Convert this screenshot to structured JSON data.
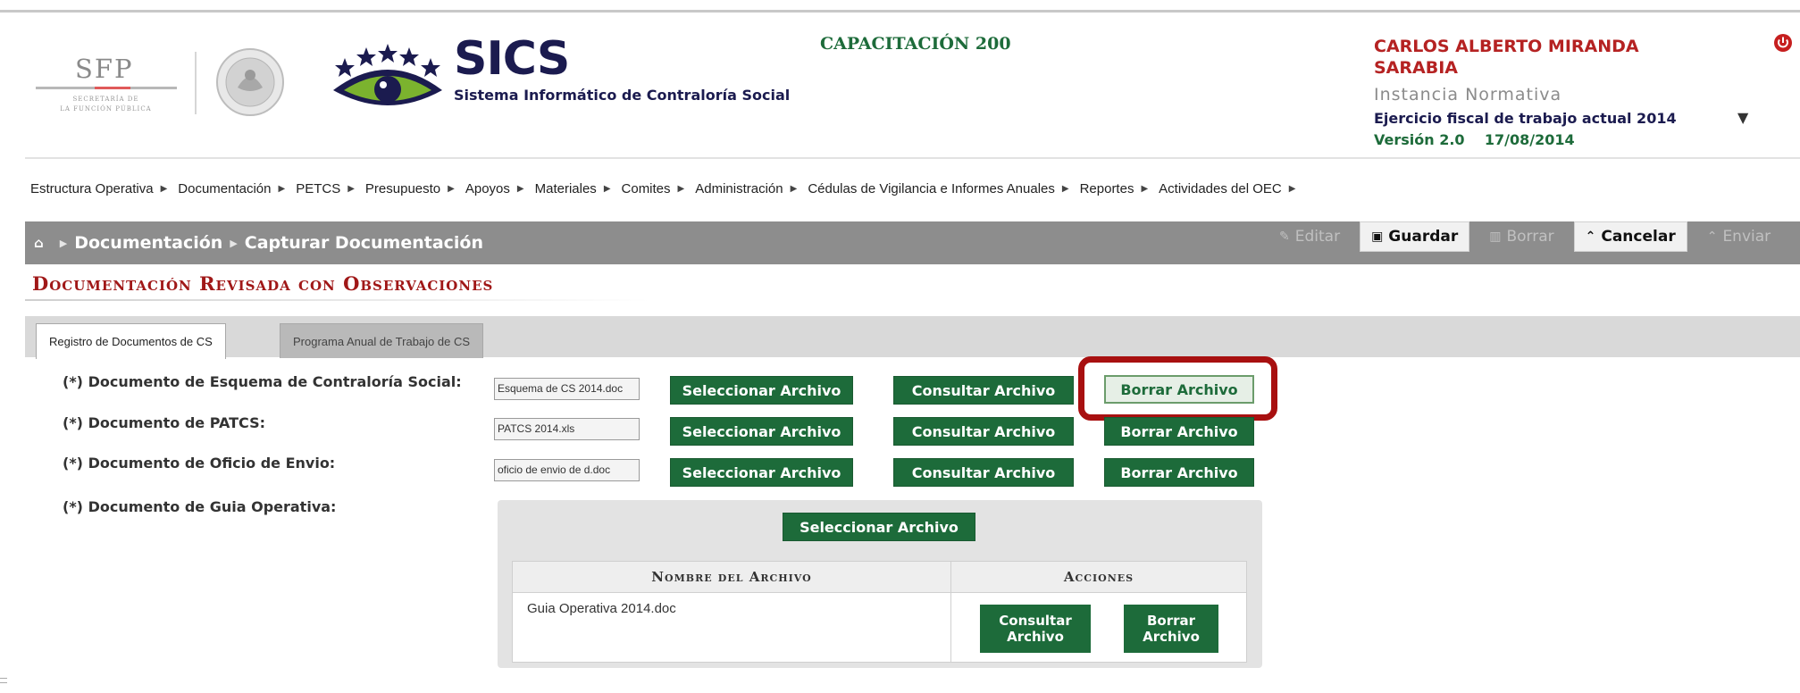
{
  "header": {
    "sfp_logo": {
      "text": "SFP",
      "line1": "SECRETARÍA DE",
      "line2": "LA FUNCIÓN PÚBLICA"
    },
    "app_title": "SICS",
    "app_subtitle": "Sistema Informático de Contraloría Social",
    "environment": "CAPACITACIÓN 200",
    "user_name": "CARLOS ALBERTO MIRANDA SARABIA",
    "user_role": "Instancia Normativa",
    "fiscal_year": "Ejercicio fiscal de trabajo actual 2014",
    "version": "Versión 2.0",
    "date": "17/08/2014"
  },
  "menu": [
    "Estructura Operativa",
    "Documentación",
    "PETCS",
    "Presupuesto",
    "Apoyos",
    "Materiales",
    "Comites",
    "Administración",
    "Cédulas de Vigilancia e Informes Anuales",
    "Reportes",
    "Actividades del OEC"
  ],
  "breadcrumb": {
    "section": "Documentación",
    "page": "Capturar Documentación"
  },
  "toolbar": {
    "edit": "Editar",
    "save": "Guardar",
    "delete": "Borrar",
    "cancel": "Cancelar",
    "send": "Enviar"
  },
  "section_title": "Documentación Revisada con Observaciones",
  "tabs": {
    "registro": "Registro de Documentos de CS",
    "programa": "Programa Anual de Trabajo de CS"
  },
  "rows": [
    {
      "label": "(*) Documento de Esquema de Contraloría Social:",
      "file": "Esquema de CS 2014.doc"
    },
    {
      "label": "(*) Documento de PATCS:",
      "file": "PATCS 2014.xls"
    },
    {
      "label": "(*) Documento de Oficio de Envio:",
      "file": "oficio de envio de d.doc"
    },
    {
      "label": "(*) Documento de Guia Operativa:"
    }
  ],
  "buttons": {
    "select": "Seleccionar Archivo",
    "consult": "Consultar Archivo",
    "delete": "Borrar Archivo",
    "consult_l1": "Consultar",
    "consult_l2": "Archivo",
    "delete_l1": "Borrar",
    "delete_l2": "Archivo"
  },
  "upload_table": {
    "col_name": "Nombre del Archivo",
    "col_actions": "Acciones",
    "file": "Guia Operativa 2014.doc"
  },
  "colors": {
    "brand_green": "#1d6b3a",
    "alert_red": "#a81010",
    "navy": "#1b1b4f"
  }
}
